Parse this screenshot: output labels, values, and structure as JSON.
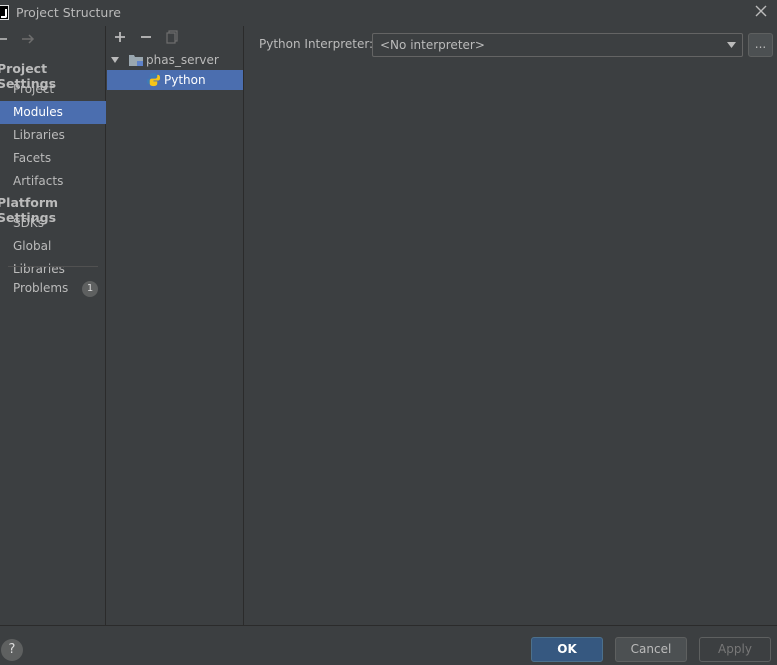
{
  "window": {
    "title": "Project Structure"
  },
  "nav": {
    "groups": [
      {
        "label": "Project Settings"
      },
      {
        "label": "Platform Settings"
      }
    ],
    "items": [
      {
        "label": "Project"
      },
      {
        "label": "Modules"
      },
      {
        "label": "Libraries"
      },
      {
        "label": "Facets"
      },
      {
        "label": "Artifacts"
      },
      {
        "label": "SDKs"
      },
      {
        "label": "Global Libraries"
      },
      {
        "label": "Problems",
        "badge": "1"
      }
    ],
    "selected": "Modules"
  },
  "tree": {
    "nodes": [
      {
        "label": "phas_server",
        "icon": "folder-icon",
        "expanded": true
      },
      {
        "label": "Python",
        "icon": "python-icon",
        "selected": true
      }
    ]
  },
  "content": {
    "interpreter_label": "Python Interpreter:",
    "interpreter_value": "<No interpreter>",
    "more_label": "..."
  },
  "footer": {
    "help_label": "?",
    "ok_label": "OK",
    "cancel_label": "Cancel",
    "apply_label": "Apply"
  },
  "colors": {
    "background": "#3c3f41",
    "selection": "#4b6eaf",
    "ok_button": "#365880",
    "text": "#bbbbbb"
  }
}
